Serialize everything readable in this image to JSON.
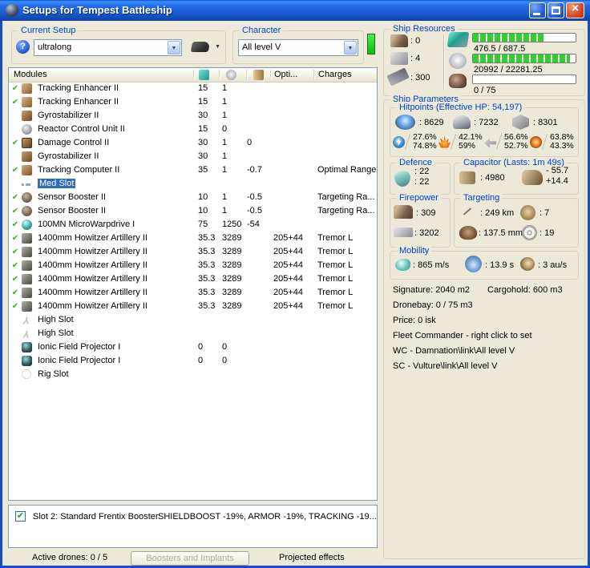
{
  "window": {
    "title": "Setups for Tempest Battleship"
  },
  "current_setup": {
    "label": "Current Setup",
    "value": "ultralong"
  },
  "character": {
    "label": "Character",
    "value": "All level V"
  },
  "ship_resources": {
    "label": "Ship Resources",
    "turret_slots": ": 0",
    "launcher_slots": ": 4",
    "calibration": ": 300",
    "cpu": {
      "used": 476.5,
      "total": 687.5,
      "text": "476.5 / 687.5"
    },
    "powergrid": {
      "used": 20992,
      "total": 22281.25,
      "text": "20992 / 22281.25"
    },
    "drones": {
      "used": 0,
      "total": 75,
      "text": "0 / 75"
    }
  },
  "modules_table": {
    "header": {
      "modules": "Modules",
      "opti": "Opti...",
      "charges": "Charges"
    },
    "rows": [
      {
        "fitted": true,
        "selected": false,
        "icon": "tracking-enhancer",
        "name": "Tracking Enhancer II",
        "cpu": "15",
        "pg": "1",
        "cap": "",
        "opti": "",
        "charge": ""
      },
      {
        "fitted": true,
        "selected": false,
        "icon": "tracking-enhancer",
        "name": "Tracking Enhancer II",
        "cpu": "15",
        "pg": "1",
        "cap": "",
        "opti": "",
        "charge": ""
      },
      {
        "fitted": false,
        "selected": false,
        "icon": "gyrostabilizer",
        "name": "Gyrostabilizer II",
        "cpu": "30",
        "pg": "1",
        "cap": "",
        "opti": "",
        "charge": ""
      },
      {
        "fitted": false,
        "selected": false,
        "icon": "reactor-control",
        "name": "Reactor Control Unit II",
        "cpu": "15",
        "pg": "0",
        "cap": "",
        "opti": "",
        "charge": ""
      },
      {
        "fitted": true,
        "selected": false,
        "icon": "damage-control",
        "name": "Damage Control II",
        "cpu": "30",
        "pg": "1",
        "cap": "0",
        "opti": "",
        "charge": ""
      },
      {
        "fitted": false,
        "selected": false,
        "icon": "gyrostabilizer",
        "name": "Gyrostabilizer II",
        "cpu": "30",
        "pg": "1",
        "cap": "",
        "opti": "",
        "charge": ""
      },
      {
        "fitted": true,
        "selected": false,
        "icon": "tracking-computer",
        "name": "Tracking Computer II",
        "cpu": "35",
        "pg": "1",
        "cap": "-0.7",
        "opti": "",
        "charge": "Optimal Range"
      },
      {
        "fitted": false,
        "selected": true,
        "icon": "med-slot",
        "name": "Med Slot",
        "cpu": "",
        "pg": "",
        "cap": "",
        "opti": "",
        "charge": ""
      },
      {
        "fitted": true,
        "selected": false,
        "icon": "sensor-booster",
        "name": "Sensor Booster II",
        "cpu": "10",
        "pg": "1",
        "cap": "-0.5",
        "opti": "",
        "charge": "Targeting Ra..."
      },
      {
        "fitted": true,
        "selected": false,
        "icon": "sensor-booster",
        "name": "Sensor Booster II",
        "cpu": "10",
        "pg": "1",
        "cap": "-0.5",
        "opti": "",
        "charge": "Targeting Ra..."
      },
      {
        "fitted": true,
        "selected": false,
        "icon": "mwd",
        "name": "100MN MicroWarpdrive I",
        "cpu": "75",
        "pg": "1250",
        "cap": "-54",
        "opti": "",
        "charge": ""
      },
      {
        "fitted": true,
        "selected": false,
        "icon": "artillery",
        "name": "1400mm Howitzer Artillery II",
        "cpu": "35.3",
        "pg": "3289",
        "cap": "",
        "opti": "205+44",
        "charge": "Tremor L"
      },
      {
        "fitted": true,
        "selected": false,
        "icon": "artillery",
        "name": "1400mm Howitzer Artillery II",
        "cpu": "35.3",
        "pg": "3289",
        "cap": "",
        "opti": "205+44",
        "charge": "Tremor L"
      },
      {
        "fitted": true,
        "selected": false,
        "icon": "artillery",
        "name": "1400mm Howitzer Artillery II",
        "cpu": "35.3",
        "pg": "3289",
        "cap": "",
        "opti": "205+44",
        "charge": "Tremor L"
      },
      {
        "fitted": true,
        "selected": false,
        "icon": "artillery",
        "name": "1400mm Howitzer Artillery II",
        "cpu": "35.3",
        "pg": "3289",
        "cap": "",
        "opti": "205+44",
        "charge": "Tremor L"
      },
      {
        "fitted": true,
        "selected": false,
        "icon": "artillery",
        "name": "1400mm Howitzer Artillery II",
        "cpu": "35.3",
        "pg": "3289",
        "cap": "",
        "opti": "205+44",
        "charge": "Tremor L"
      },
      {
        "fitted": true,
        "selected": false,
        "icon": "artillery",
        "name": "1400mm Howitzer Artillery II",
        "cpu": "35.3",
        "pg": "3289",
        "cap": "",
        "opti": "205+44",
        "charge": "Tremor L"
      },
      {
        "fitted": false,
        "selected": false,
        "icon": "high-slot",
        "name": "High Slot",
        "cpu": "",
        "pg": "",
        "cap": "",
        "opti": "",
        "charge": ""
      },
      {
        "fitted": false,
        "selected": false,
        "icon": "high-slot",
        "name": "High Slot",
        "cpu": "",
        "pg": "",
        "cap": "",
        "opti": "",
        "charge": ""
      },
      {
        "fitted": false,
        "selected": false,
        "icon": "ionic-field",
        "name": "Ionic Field Projector I",
        "cpu": "0",
        "pg": "0",
        "cap": "",
        "opti": "",
        "charge": ""
      },
      {
        "fitted": false,
        "selected": false,
        "icon": "ionic-field",
        "name": "Ionic Field Projector I",
        "cpu": "0",
        "pg": "0",
        "cap": "",
        "opti": "",
        "charge": ""
      },
      {
        "fitted": false,
        "selected": false,
        "icon": "rig-slot",
        "name": "Rig Slot",
        "cpu": "",
        "pg": "",
        "cap": "",
        "opti": "",
        "charge": ""
      }
    ]
  },
  "booster_panel": {
    "checked": true,
    "label": "Slot 2: Standard Frentix Booster",
    "effects": "SHIELDBOOST -19%, ARMOR -19%, TRACKING -19..."
  },
  "bottom_bar": {
    "active_drones": "Active drones: 0 / 5",
    "boosters_button": "Boosters and Implants",
    "projected_effects": "Projected effects"
  },
  "ship_parameters": {
    "label": "Ship Parameters",
    "hitpoints": {
      "label": "Hitpoints (Effective HP: 54,197)",
      "shield": ": 8629",
      "armor": ": 7232",
      "structure": ": 8301",
      "resists": [
        {
          "type": "em",
          "shield": "27.6%",
          "armor": "74.8%"
        },
        {
          "type": "thermal",
          "shield": "42.1%",
          "armor": "59%"
        },
        {
          "type": "kinetic",
          "shield": "56.6%",
          "armor": "52.7%"
        },
        {
          "type": "explosive",
          "shield": "63.8%",
          "armor": "43.3%"
        }
      ]
    },
    "defence": {
      "label": "Defence",
      "value1": ": 22",
      "value2": ": 22"
    },
    "capacitor": {
      "label": "Capacitor (Lasts: 1m 49s)",
      "amount": ": 4980",
      "drain": "- 55.7",
      "recharge": "+14.4"
    },
    "firepower": {
      "label": "Firepower",
      "dps": ": 309",
      "volley": ": 3202"
    },
    "targeting": {
      "label": "Targeting",
      "range": ": 249 km",
      "signature_resolution": ": 137.5 mm",
      "max_targets": ": 7",
      "scan_resolution": ": 19"
    },
    "mobility": {
      "label": "Mobility",
      "speed": ": 865 m/s",
      "align_time": ": 13.9 s",
      "warp_speed": ": 3 au/s"
    },
    "info": {
      "signature": "Signature: 2040 m2",
      "cargohold": "Cargohold: 600 m3",
      "dronebay": "Dronebay: 0 / 75 m3",
      "price": "Price: 0 isk",
      "fleet_commander": "Fleet Commander - right click to set",
      "wc": "WC - Damnation\\link\\All level V",
      "sc": "SC - Vulture\\link\\All level V"
    }
  }
}
